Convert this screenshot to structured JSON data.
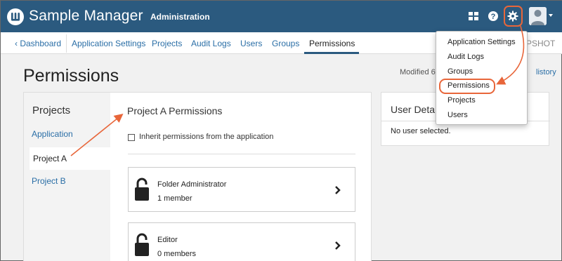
{
  "app": {
    "name": "Sample Manager",
    "section": "Administration"
  },
  "top_icons": [
    "grid-icon",
    "help-icon",
    "gear-icon",
    "user-avatar"
  ],
  "nav": {
    "back_label": "Dashboard",
    "items": [
      {
        "label": "Application Settings"
      },
      {
        "label": "Projects"
      },
      {
        "label": "Audit Logs"
      },
      {
        "label": "Users"
      },
      {
        "label": "Groups"
      },
      {
        "label": "Permissions",
        "active": true
      }
    ],
    "snapshot_text": "APSHOT"
  },
  "page": {
    "title": "Permissions",
    "modified_text": "Modified 6",
    "history_link": "listory"
  },
  "projects": {
    "heading": "Projects",
    "items": [
      {
        "label": "Application",
        "selected": false
      },
      {
        "label": "Project A",
        "selected": true
      },
      {
        "label": "Project B",
        "selected": false
      }
    ]
  },
  "permissions": {
    "title": "Project A Permissions",
    "inherit_label": "Inherit permissions from the application",
    "inherit_checked": false,
    "roles": [
      {
        "name": "Folder Administrator",
        "members": "1 member"
      },
      {
        "name": "Editor",
        "members": "0 members"
      }
    ]
  },
  "user_details": {
    "title": "User Deta",
    "empty_text": "No user selected."
  },
  "settings_menu": {
    "items": [
      {
        "label": "Application Settings"
      },
      {
        "label": "Audit Logs"
      },
      {
        "label": "Groups"
      },
      {
        "label": "Permissions",
        "highlighted": true
      },
      {
        "label": "Projects"
      },
      {
        "label": "Users"
      }
    ]
  },
  "colors": {
    "header_bg": "#2b5a7f",
    "link": "#2a6ea6",
    "annotation": "#e8663a"
  }
}
